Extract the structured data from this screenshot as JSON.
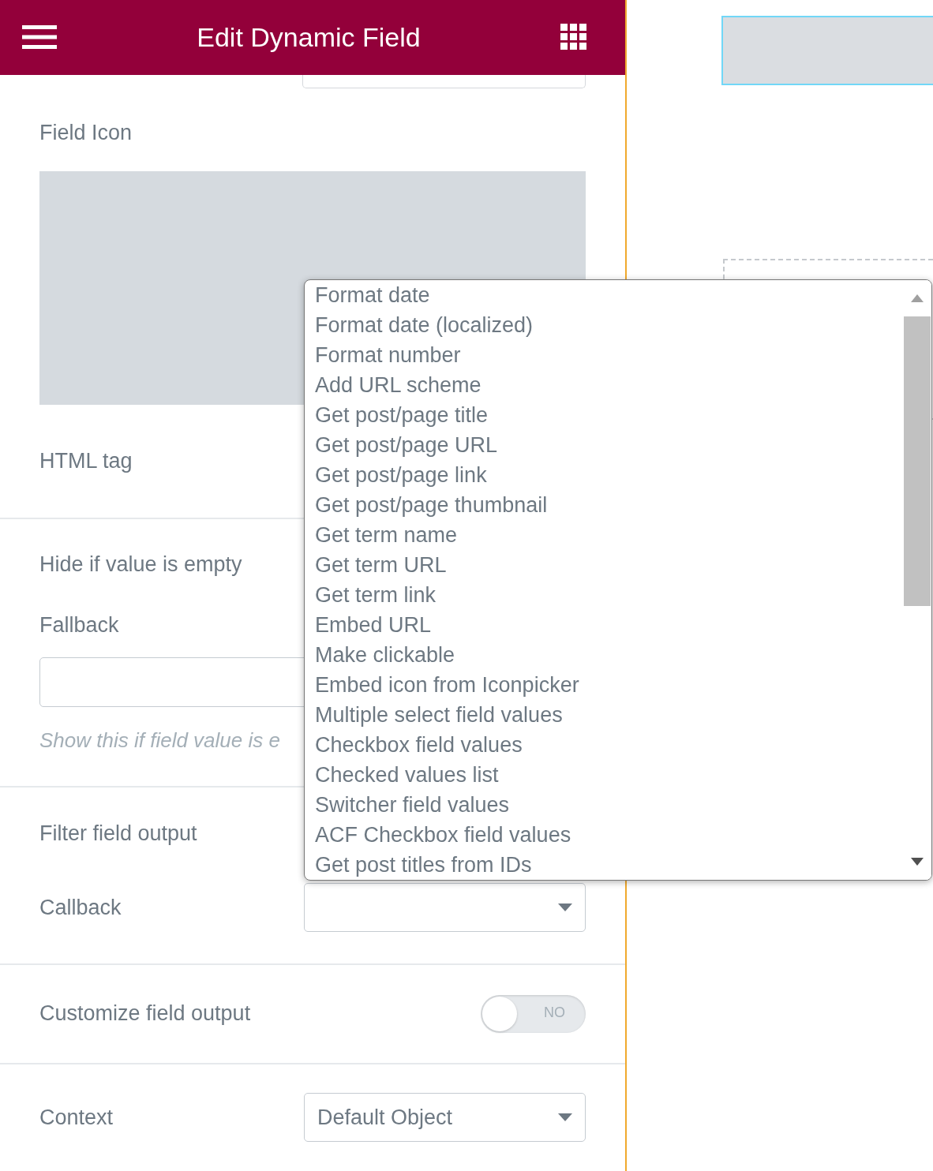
{
  "header": {
    "title": "Edit Dynamic Field"
  },
  "panel": {
    "field_icon_label": "Field Icon",
    "html_tag_label": "HTML tag",
    "hide_empty_label": "Hide if value is empty",
    "fallback_label": "Fallback",
    "fallback_hint": "Show this if field value is e",
    "filter_label": "Filter field output",
    "callback_label": "Callback",
    "customize_label": "Customize field output",
    "customize_toggle": {
      "on": false,
      "label": "NO"
    },
    "context_label": "Context",
    "context_value": "Default Object"
  },
  "dropdown": {
    "options": [
      {
        "label": "Format date",
        "selected": false
      },
      {
        "label": "Format date (localized)",
        "selected": false
      },
      {
        "label": "Format number",
        "selected": false
      },
      {
        "label": "Add URL scheme",
        "selected": false
      },
      {
        "label": "Get post/page title",
        "selected": false
      },
      {
        "label": "Get post/page URL",
        "selected": false
      },
      {
        "label": "Get post/page link",
        "selected": false
      },
      {
        "label": "Get post/page thumbnail",
        "selected": false
      },
      {
        "label": "Get term name",
        "selected": false
      },
      {
        "label": "Get term URL",
        "selected": false
      },
      {
        "label": "Get term link",
        "selected": false
      },
      {
        "label": "Embed URL",
        "selected": false
      },
      {
        "label": "Make clickable",
        "selected": false
      },
      {
        "label": "Embed icon from Iconpicker",
        "selected": false
      },
      {
        "label": "Multiple select field values",
        "selected": false
      },
      {
        "label": "Checkbox field values",
        "selected": false
      },
      {
        "label": "Checked values list",
        "selected": false
      },
      {
        "label": "Switcher field values",
        "selected": false
      },
      {
        "label": "ACF Checkbox field values",
        "selected": false
      },
      {
        "label": "Get post titles from IDs",
        "selected": false
      }
    ]
  }
}
